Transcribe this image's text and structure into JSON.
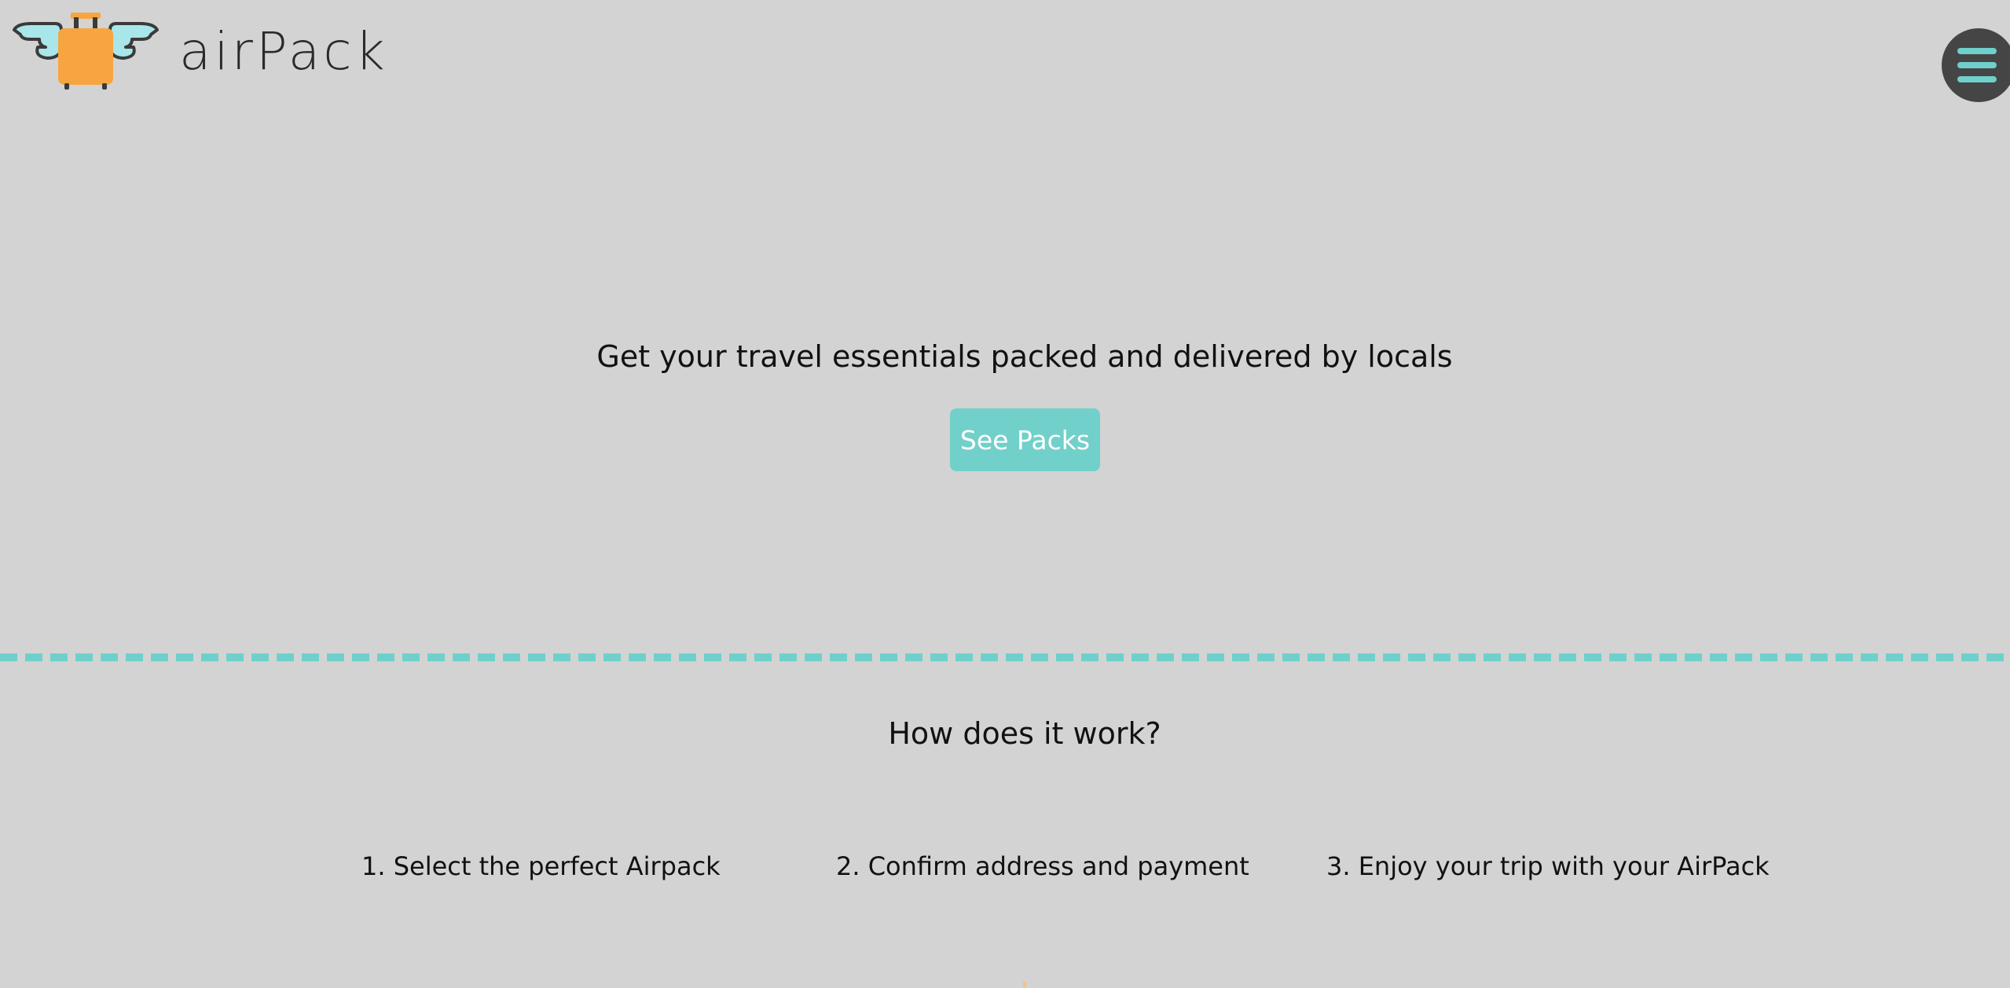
{
  "header": {
    "brand_name": "airPack",
    "logo_icon": "winged-suitcase-icon",
    "menu_icon": "hamburger-menu-icon"
  },
  "hero": {
    "headline": "Get your travel essentials packed and delivered by locals",
    "cta_label": "See Packs"
  },
  "how_it_works": {
    "title": "How does it work?",
    "steps": [
      {
        "label": "1. Select the perfect Airpack"
      },
      {
        "label": "2. Confirm address and payment"
      },
      {
        "label": "3. Enjoy your trip with your AirPack"
      }
    ]
  },
  "colors": {
    "background": "#d3d3d3",
    "accent_teal": "#72d0ca",
    "suitcase_orange": "#f7a540",
    "menu_dark": "#454545"
  }
}
